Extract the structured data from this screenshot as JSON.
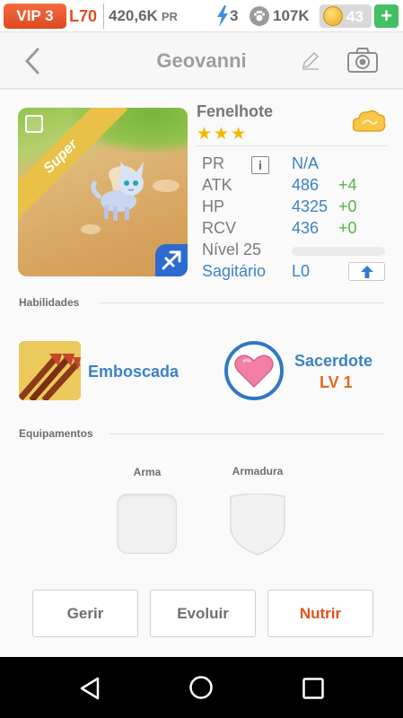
{
  "status": {
    "vip_label": "VIP 3",
    "level": "L70",
    "power_value": "420,6K",
    "power_unit": "PR",
    "energy": "3",
    "paws": "107K",
    "coins": "43",
    "add_label": "+"
  },
  "header": {
    "title": "Geovanni"
  },
  "pet": {
    "rarity": "Super",
    "family": "Fenelhote",
    "stars": [
      "★",
      "★",
      "★"
    ],
    "stats": {
      "pr_label": "PR",
      "pr_info": "i",
      "pr_value": "N/A",
      "atk_label": "ATK",
      "atk_value": "486",
      "atk_bonus": "+4",
      "hp_label": "HP",
      "hp_value": "4325",
      "hp_bonus": "+0",
      "rcv_label": "RCV",
      "rcv_value": "436",
      "rcv_bonus": "+0",
      "level_label": "Nível 25",
      "level_progress": 0.0,
      "sign_label": "Sagitário",
      "sign_level": "L0"
    }
  },
  "skills": {
    "section_label": "Habilidades",
    "active_name": "Emboscada",
    "leader_name": "Sacerdote",
    "leader_level": "LV 1"
  },
  "equipment": {
    "section_label": "Equipamentos",
    "weapon_label": "Arma",
    "armor_label": "Armadura"
  },
  "actions": {
    "manage": "Gerir",
    "evolve": "Evoluir",
    "feed": "Nutrir"
  },
  "colors": {
    "accent_blue": "#3b82c6",
    "accent_orange": "#e2521c",
    "bonus_green": "#55b444",
    "vip_orange": "#de4a1e"
  }
}
